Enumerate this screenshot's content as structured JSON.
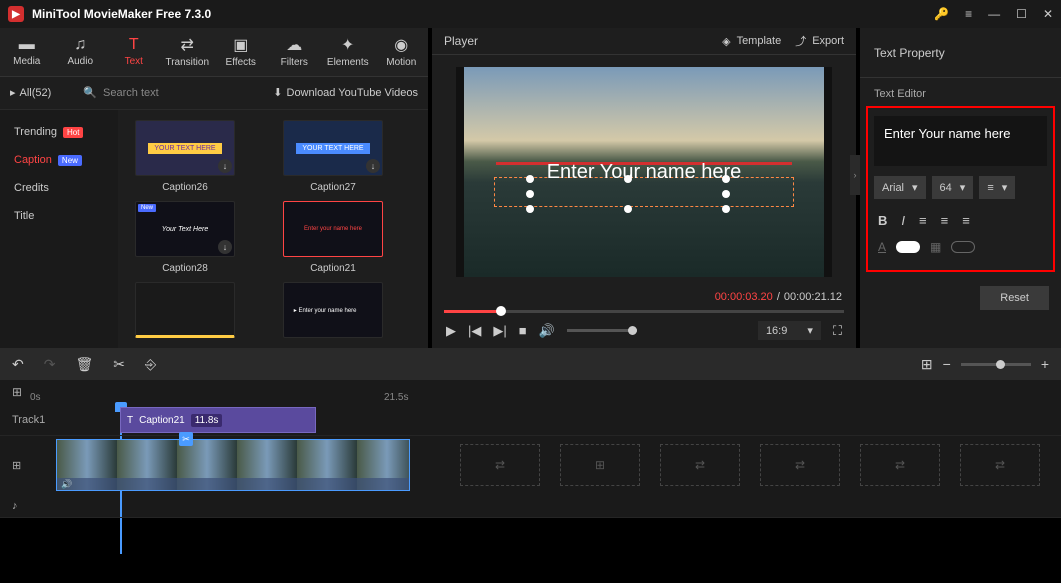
{
  "app": {
    "title": "MiniTool MovieMaker Free 7.3.0"
  },
  "toolbar": {
    "tabs": [
      {
        "icon": "folder",
        "label": "Media"
      },
      {
        "icon": "music",
        "label": "Audio"
      },
      {
        "icon": "text",
        "label": "Text"
      },
      {
        "icon": "swap",
        "label": "Transition"
      },
      {
        "icon": "stack",
        "label": "Effects"
      },
      {
        "icon": "cloud",
        "label": "Filters"
      },
      {
        "icon": "sparkle",
        "label": "Elements"
      },
      {
        "icon": "motion",
        "label": "Motion"
      }
    ]
  },
  "filter": {
    "all": "All(52)",
    "search_ph": "Search text",
    "download": "Download YouTube Videos"
  },
  "categories": [
    {
      "label": "Trending",
      "badge": "Hot",
      "badge_cls": "hot"
    },
    {
      "label": "Caption",
      "badge": "New",
      "badge_cls": "new",
      "active": true
    },
    {
      "label": "Credits"
    },
    {
      "label": "Title"
    }
  ],
  "thumbs": [
    {
      "label": "Caption26",
      "txt": "YOUR TEXT HERE",
      "dl": true
    },
    {
      "label": "Caption27",
      "txt": "YOUR TEXT HERE",
      "dl": true
    },
    {
      "label": "Caption28",
      "txt": "Your Text Here",
      "dl": true,
      "new": true
    },
    {
      "label": "Caption21",
      "txt": "Enter your name here",
      "selected": true
    },
    {
      "label": "",
      "txt": ""
    },
    {
      "label": "",
      "txt": "Enter your name here"
    }
  ],
  "player": {
    "title": "Player",
    "template": "Template",
    "export": "Export",
    "overlay_text": "Enter Your name here",
    "time_current": "00:00:03.20",
    "time_sep": " / ",
    "time_total": "00:00:21.12",
    "ratio": "16:9"
  },
  "text_prop": {
    "title": "Text Property",
    "editor_label": "Text Editor",
    "value": "Enter Your name here",
    "font": "Arial",
    "size": "64",
    "reset": "Reset"
  },
  "timeline": {
    "ruler_start": "0s",
    "ruler_mid": "21.5s",
    "track1": "Track1",
    "clip_name": "Caption21",
    "clip_dur": "11.8s"
  }
}
